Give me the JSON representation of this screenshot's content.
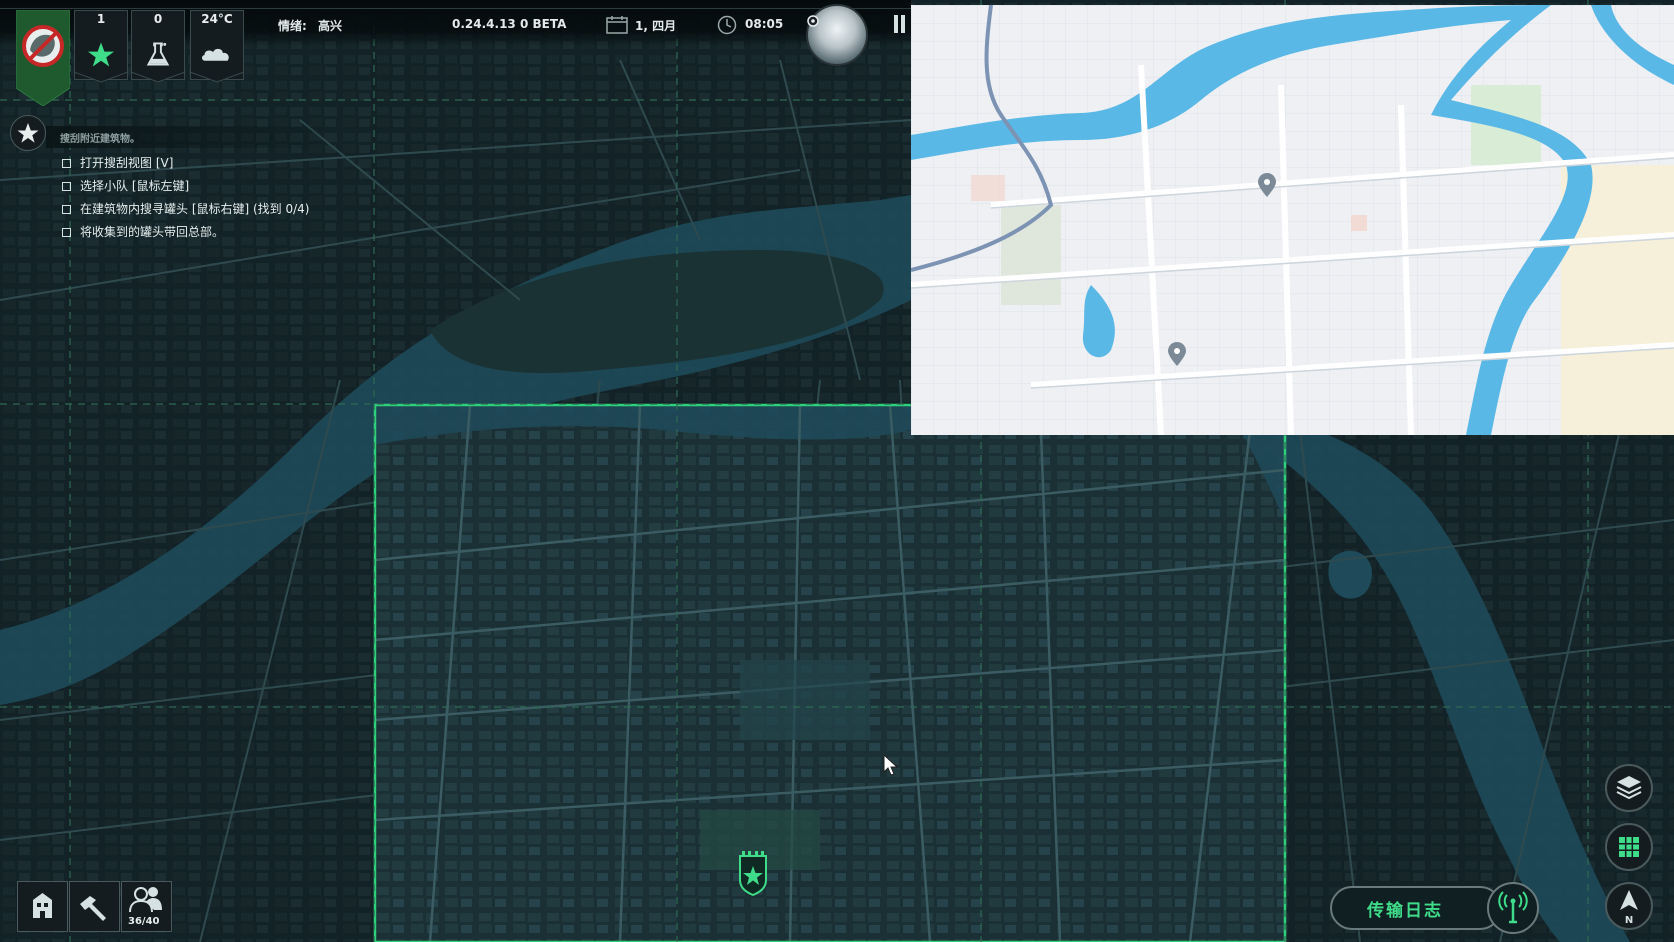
{
  "hud": {
    "stats": [
      {
        "value": "1",
        "icon": "star-icon"
      },
      {
        "value": "0",
        "icon": "flask-icon"
      },
      {
        "value": "24°C",
        "icon": "cloud-icon"
      }
    ],
    "mood_label": "情绪:",
    "mood_value": "高兴",
    "version": "0.24.4.13 0 BETA",
    "date": "1, 四月",
    "time": "08:05"
  },
  "objectives": {
    "title": "搜刮附近建筑物。",
    "items": [
      "打开搜刮视图 [V]",
      "选择小队 [鼠标左键]",
      "在建筑物内搜寻罐头 [鼠标右键] (找到 0/4)",
      "将收集到的罐头带回总部。"
    ]
  },
  "toolbar": {
    "squad_count": "36/40"
  },
  "transmission_log": {
    "label": "传输日志"
  },
  "right_buttons": [
    "layers-icon",
    "grid-icon",
    "compass-north-icon"
  ],
  "compass_label": "N",
  "colors": {
    "accent_green": "#3fdc8a",
    "selection_green": "#2fd07a",
    "river_dark": "#1e4a5a",
    "river_light": "#5ab8e6",
    "map_background": "#0c1a1e"
  }
}
